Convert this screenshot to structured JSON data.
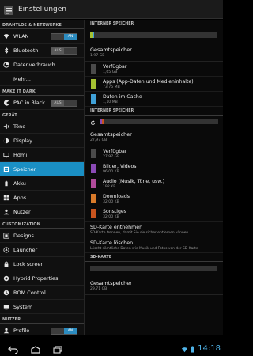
{
  "header": {
    "title": "Einstellungen",
    "icon": "settings-app-icon"
  },
  "sidebar": {
    "sections": [
      {
        "title": "DRAHTLOS & NETZWERKE",
        "items": [
          {
            "label": "WLAN",
            "icon": "wifi-icon",
            "toggle": "AN"
          },
          {
            "label": "Bluetooth",
            "icon": "bluetooth-icon",
            "toggle": "AUS"
          },
          {
            "label": "Datenverbrauch",
            "icon": "data-usage-icon"
          },
          {
            "label": "Mehr...",
            "icon": ""
          }
        ]
      },
      {
        "title": "MAKE IT DARK",
        "items": [
          {
            "label": "PAC in Black",
            "icon": "pac-icon",
            "toggle": "AUS"
          }
        ]
      },
      {
        "title": "GERÄT",
        "items": [
          {
            "label": "Töne",
            "icon": "volume-icon"
          },
          {
            "label": "Display",
            "icon": "brightness-icon"
          },
          {
            "label": "Hdmi",
            "icon": "hdmi-icon"
          },
          {
            "label": "Speicher",
            "icon": "storage-icon",
            "selected": true
          },
          {
            "label": "Akku",
            "icon": "battery-icon"
          },
          {
            "label": "Apps",
            "icon": "apps-icon"
          },
          {
            "label": "Nutzer",
            "icon": "user-icon"
          }
        ]
      },
      {
        "title": "CUSTOMIZATION",
        "items": [
          {
            "label": "Designs",
            "icon": "themes-icon"
          },
          {
            "label": "Launcher",
            "icon": "launcher-icon"
          },
          {
            "label": "Lock screen",
            "icon": "lock-icon"
          },
          {
            "label": "Hybrid Properties",
            "icon": "hybrid-icon"
          },
          {
            "label": "ROM Control",
            "icon": "rom-control-icon"
          },
          {
            "label": "System",
            "icon": "system-icon"
          }
        ]
      },
      {
        "title": "NUTZER",
        "items": [
          {
            "label": "Profile",
            "icon": "profile-icon",
            "toggle": "AN"
          }
        ]
      }
    ]
  },
  "internal": {
    "header": "INTERNER SPEICHER",
    "total_label": "Gesamtspeicher",
    "total_size": "1,97 GB",
    "categories": [
      {
        "label": "Verfügbar",
        "size": "1,65 GB",
        "color": "#4a4a4a"
      },
      {
        "label": "Apps (App-Daten und Medieninhalte)",
        "size": "73,75 MB",
        "color": "#a5c132"
      },
      {
        "label": "Daten im Cache",
        "size": "1,10 MB",
        "color": "#3fa0d6"
      }
    ]
  },
  "shared": {
    "header": "INTERNER SPEICHER",
    "total_label": "Gesamtspeicher",
    "total_size": "27,97 GB",
    "categories": [
      {
        "label": "Verfügbar",
        "size": "27,97 GB",
        "color": "#4a4a4a"
      },
      {
        "label": "Bilder, Videos",
        "size": "96,00 KB",
        "color": "#8a4ab5"
      },
      {
        "label": "Audio (Musik, Töne, usw.)",
        "size": "192 KB",
        "color": "#b04a9a"
      },
      {
        "label": "Downloads",
        "size": "32,00 KB",
        "color": "#d87a2a"
      },
      {
        "label": "Sonstiges",
        "size": "32,00 KB",
        "color": "#c8541e"
      }
    ],
    "actions": [
      {
        "title": "SD-Karte entnehmen",
        "desc": "SD-Karte trennen, damit Sie sie sicher entfernen können"
      },
      {
        "title": "SD-Karte löschen",
        "desc": "Löscht sämtliche Daten wie Musik und Fotos von der SD-Karte"
      }
    ]
  },
  "sdcard": {
    "header": "SD-KARTE",
    "total_label": "Gesamtspeicher",
    "total_size": "29,71 GB"
  },
  "statusbar": {
    "time": "14:18"
  },
  "colors": {
    "accent": "#1a8fc4",
    "clock": "#4fb3e8"
  }
}
